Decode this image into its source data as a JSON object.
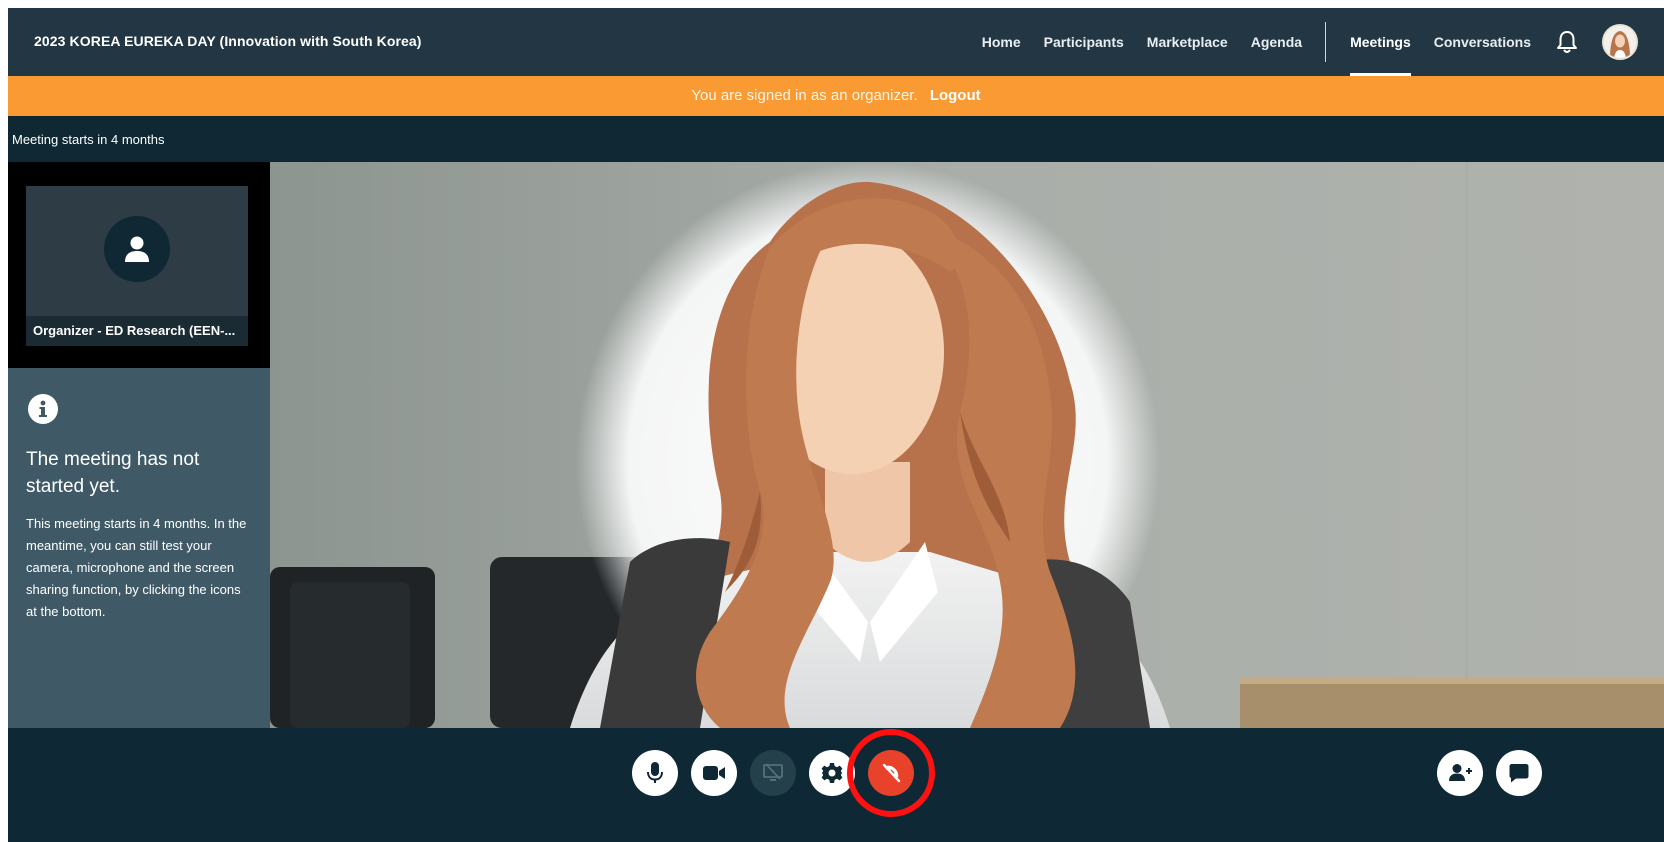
{
  "header": {
    "event_title": "2023 KOREA EUREKA DAY (Innovation with South Korea)",
    "nav": [
      {
        "label": "Home"
      },
      {
        "label": "Participants"
      },
      {
        "label": "Marketplace"
      },
      {
        "label": "Agenda"
      },
      {
        "label": "Meetings",
        "active": true
      },
      {
        "label": "Conversations"
      }
    ],
    "icons": [
      "bell-icon",
      "user-avatar"
    ]
  },
  "banner": {
    "text": "You are signed in as an organizer.",
    "logout_label": "Logout",
    "color": "#fa9a32"
  },
  "meeting": {
    "status_text": "Meeting starts in 4 months"
  },
  "participant_tile": {
    "name": "Organizer - ED Research (EEN-..."
  },
  "info_panel": {
    "icon": "info-icon",
    "title": "The meeting has not started yet.",
    "body": "This meeting starts in 4 months. In the meantime, you can still test your camera, microphone and the screen sharing function, by clicking the icons at the bottom."
  },
  "controls": {
    "center": [
      "microphone-icon",
      "camera-icon",
      "screen-share-icon (disabled)",
      "settings-icon",
      "hang-up-icon (highlighted)"
    ],
    "right": [
      "add-participant-icon",
      "chat-icon"
    ],
    "hangup_color": "#e8432a",
    "highlight_color": "#ff1111"
  }
}
